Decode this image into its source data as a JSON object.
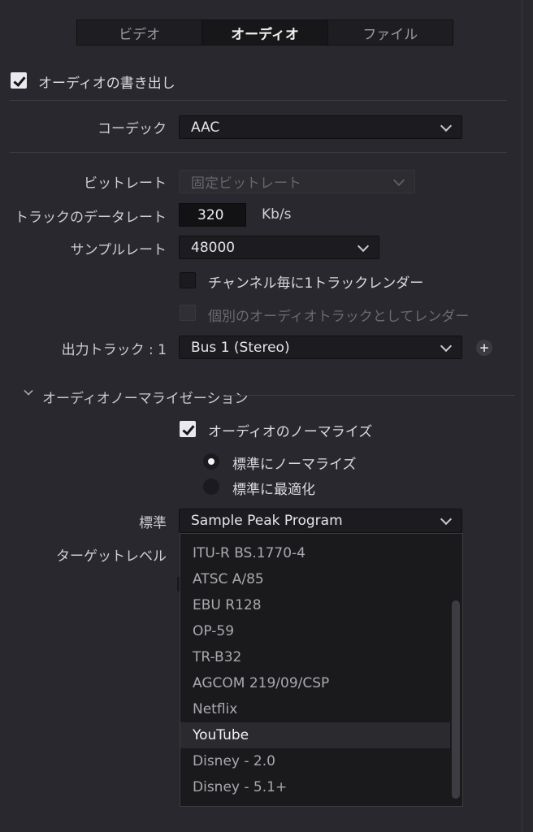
{
  "tabs": [
    "ビデオ",
    "オーディオ",
    "ファイル"
  ],
  "export_audio": {
    "label": "オーディオの書き出し",
    "checked": true
  },
  "codec": {
    "label": "コーデック",
    "value": "AAC"
  },
  "bitrate": {
    "label": "ビットレート",
    "value": "固定ビットレート"
  },
  "track_data_rate": {
    "label": "トラックのデータレート",
    "value": "320",
    "unit": "Kb/s"
  },
  "sample_rate": {
    "label": "サンプルレート",
    "value": "48000"
  },
  "render_one_track": {
    "label": "チャンネル毎に1トラックレンダー",
    "checked": false
  },
  "render_separate": {
    "label": "個別のオーディオトラックとしてレンダー",
    "checked": false
  },
  "output_track": {
    "label": "出力トラック : 1",
    "value": "Bus 1 (Stereo)"
  },
  "normalization": {
    "section_label": "オーディオノーマライゼーション",
    "normalize": {
      "label": "オーディオのノーマライズ",
      "checked": true
    },
    "radio_standard": {
      "label": "標準にノーマライズ",
      "selected": true
    },
    "radio_optimize": {
      "label": "標準に最適化",
      "selected": false
    },
    "standard_label": "標準",
    "standard_value": "Sample Peak Program",
    "target_level_label": "ターゲットレベル"
  },
  "dropdown": {
    "options": [
      "ITU-R BS.1770-4",
      "ATSC A/85",
      "EBU R128",
      "OP-59",
      "TR-B32",
      "AGCOM 219/09/CSP",
      "Netflix",
      "YouTube",
      "Disney - 2.0",
      "Disney - 5.1+"
    ],
    "highlighted": "YouTube"
  },
  "colors": {
    "background": "#28282e",
    "input_bg": "#1c1c20",
    "highlight": "#2a2a2f"
  }
}
